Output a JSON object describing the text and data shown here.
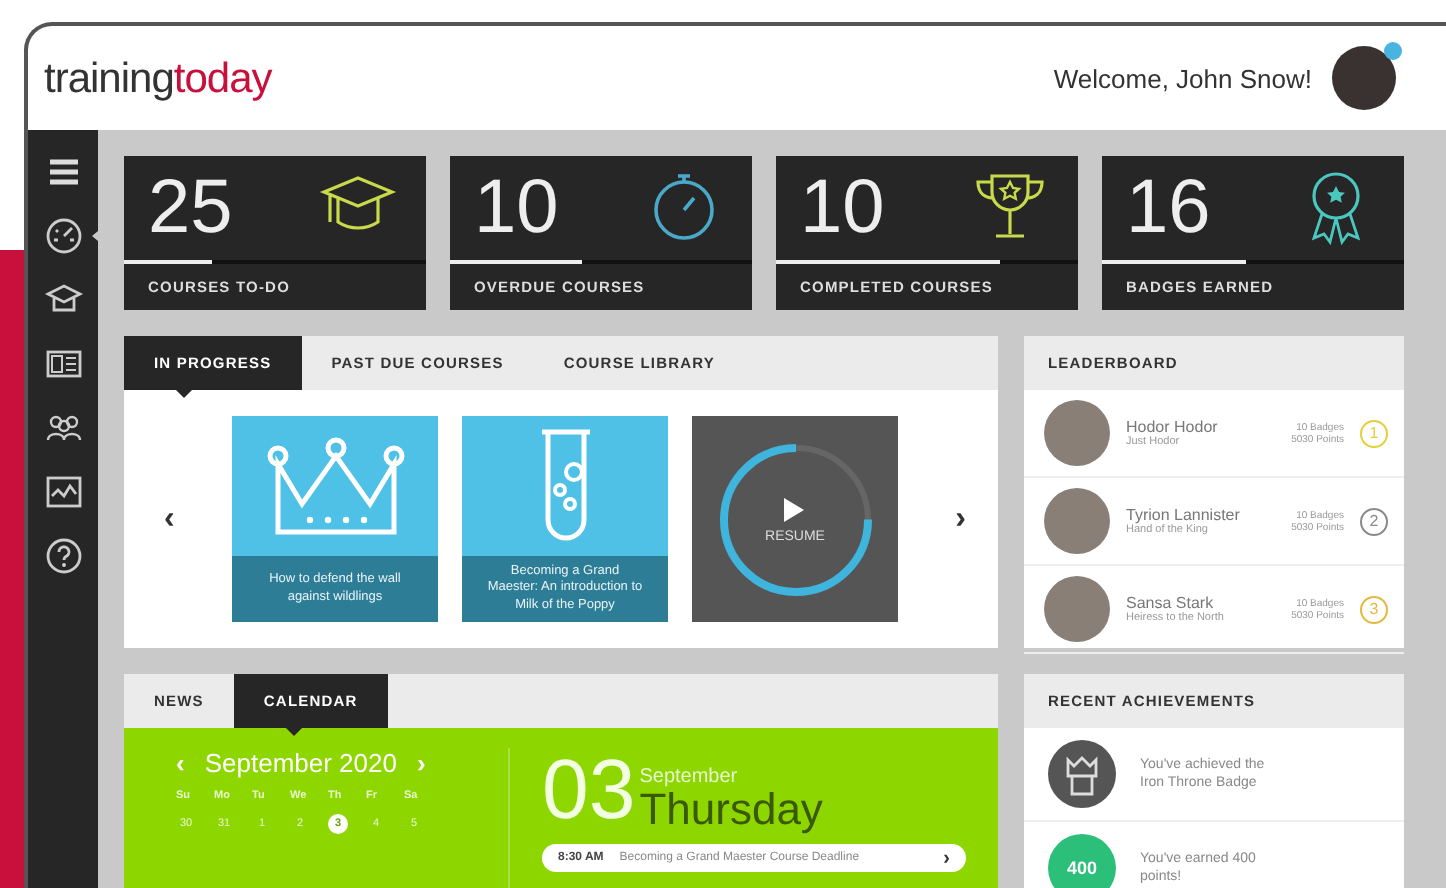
{
  "header": {
    "logo": [
      "training",
      "today"
    ],
    "welcome": "Welcome, John Snow!"
  },
  "sidebar": {
    "items": [
      {
        "kind": "menu",
        "selected": false
      },
      {
        "kind": "gauge",
        "selected": true
      },
      {
        "kind": "cap",
        "selected": false
      },
      {
        "kind": "card",
        "selected": false
      },
      {
        "kind": "people",
        "selected": false
      },
      {
        "kind": "chart",
        "selected": false
      },
      {
        "kind": "help",
        "selected": false
      }
    ]
  },
  "stats": [
    {
      "value": "25",
      "label": "COURSES TO-DO",
      "kind": "cap",
      "color": "#c8d94a",
      "level": 0.29
    },
    {
      "value": "10",
      "label": "OVERDUE COURSES",
      "kind": "stopwatch",
      "color": "#4aa8c8",
      "level": 0.44
    },
    {
      "value": "10",
      "label": "COMPLETED COURSES",
      "kind": "trophy",
      "color": "#c8d94a",
      "level": 0.74
    },
    {
      "value": "16",
      "label": "BADGES EARNED",
      "kind": "ribbon",
      "color": "#4ac8c0",
      "level": 0.48
    }
  ],
  "courses": {
    "tabs": [
      {
        "label": "IN PROGRESS",
        "selected": true
      },
      {
        "label": "PAST DUE COURSES",
        "selected": false
      },
      {
        "label": "COURSE LIBRARY",
        "selected": false
      }
    ],
    "prev": "‹",
    "next": "›",
    "cards": [
      {
        "kind": "crown",
        "title": "How to defend the wall against wildlings"
      },
      {
        "kind": "tube",
        "title": "Becoming a Grand Maester: An introduction to Milk of the Poppy"
      },
      {
        "kind": "resume",
        "label": "RESUME",
        "level": 0.75
      }
    ]
  },
  "leaderboard": {
    "title": "LEADERBOARD",
    "rows": [
      {
        "name": "Hodor Hodor",
        "subtitle": "Just Hodor",
        "badges": "10 Badges",
        "points": "5030 Points",
        "rank": "1",
        "color": "#e6cf3c"
      },
      {
        "name": "Tyrion Lannister",
        "subtitle": "Hand of the King",
        "badges": "10 Badges",
        "points": "5030 Points",
        "rank": "2",
        "color": "#8a8a8a"
      },
      {
        "name": "Sansa Stark",
        "subtitle": "Heiress to the North",
        "badges": "10 Badges",
        "points": "5030 Points",
        "rank": "3",
        "color": "#e6b83c"
      }
    ]
  },
  "calendar": {
    "tabs": [
      {
        "label": "NEWS",
        "selected": false
      },
      {
        "label": "CALENDAR",
        "selected": true
      }
    ],
    "prev": "‹",
    "month": "September 2020",
    "next": "›",
    "weekdays": [
      "Su",
      "Mo",
      "Tu",
      "We",
      "Th",
      "Fr",
      "Sa"
    ],
    "days": [
      {
        "label": "30",
        "selected": false
      },
      {
        "label": "31",
        "selected": false
      },
      {
        "label": "1",
        "selected": false
      },
      {
        "label": "2",
        "selected": false
      },
      {
        "label": "3",
        "selected": true
      },
      {
        "label": "4",
        "selected": false
      },
      {
        "label": "5",
        "selected": false
      }
    ],
    "day_number": "03",
    "day_month": "September",
    "weekday": "Thursday",
    "event": {
      "time": "8:30 AM",
      "text": "Becoming a Grand Maester Course Deadline",
      "arrow": "›"
    }
  },
  "achievements": {
    "title": "RECENT ACHIEVEMENTS",
    "items": [
      {
        "kind": "badge",
        "text": "You've achieved the Iron Throne Badge"
      },
      {
        "kind": "points",
        "badge": "400",
        "text": "You've earned 400 points!"
      }
    ]
  }
}
